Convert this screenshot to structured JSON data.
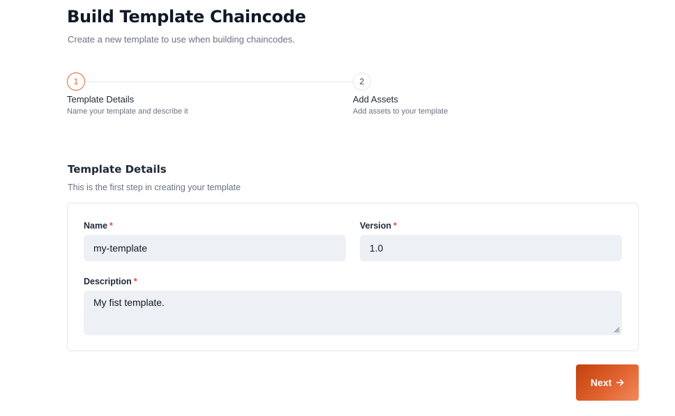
{
  "header": {
    "title": "Build Template Chaincode",
    "subtitle": "Create a new template to use when building chaincodes."
  },
  "stepper": {
    "active_step": 1,
    "steps": [
      {
        "number": "1",
        "title": "Template Details",
        "description": "Name your template and describe it"
      },
      {
        "number": "2",
        "title": "Add Assets",
        "description": "Add assets to your template"
      }
    ]
  },
  "section": {
    "title": "Template Details",
    "subtitle": "This is the first step in creating your template"
  },
  "form": {
    "name": {
      "label": "Name",
      "required_mark": "*",
      "value": "my-template"
    },
    "version": {
      "label": "Version",
      "required_mark": "*",
      "value": "1.0"
    },
    "description": {
      "label": "Description",
      "required_mark": "*",
      "value": "My fist template."
    }
  },
  "actions": {
    "next_label": "Next",
    "next_icon": "arrow-right-icon"
  },
  "colors": {
    "accent": "#e2622f",
    "required": "#ef4444",
    "input_bg": "#edf0f4"
  }
}
